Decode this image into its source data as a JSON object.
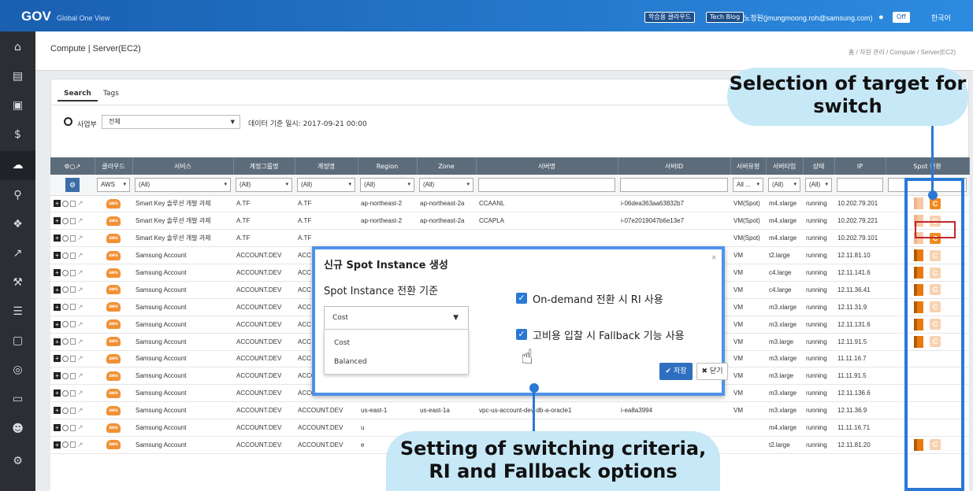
{
  "topbar": {
    "logo": "GOV",
    "logo_sub": "Global One View",
    "btn_learning": "학습용 클라우드",
    "btn_techblog": "Tech Blog",
    "user": "노정원(jmungmoong.roh@samsung.com)",
    "toggle": "Off",
    "lang": "한국어"
  },
  "page": {
    "title": "Compute | Server(EC2)",
    "breadcrumb": "홈 / 자원 관리 / Compute / Server(EC2)"
  },
  "search": {
    "tabs": [
      "Search",
      "Tags"
    ],
    "filter_label": "사업부",
    "filter_value": "전체",
    "data_date": "데이터 기준 일시: 2017-09-21 00:00"
  },
  "grid": {
    "columns": [
      "",
      "클라우드",
      "서비스",
      "계정그룹명",
      "계정명",
      "Region",
      "Zone",
      "서버명",
      "서버ID",
      "서버유형",
      "서버타입",
      "상태",
      "IP",
      "Spot 전환"
    ],
    "filters": [
      "",
      "AWS",
      "(All)",
      "(All)",
      "(All)",
      "(All)",
      "(All)",
      "",
      "",
      "All ...",
      "(All)",
      "(All)",
      "",
      ""
    ],
    "rows": [
      {
        "svc": "Smart Key 솔루션 개발 과제",
        "grp": "A.TF",
        "acct": "A.TF",
        "region": "ap-northeast-2",
        "zone": "ap-northeast-2a",
        "name": "CCAANL",
        "id": "i-06dea363aa63832b7",
        "type": "VM(Spot)",
        "itype": "m4.xlarge",
        "state": "running",
        "ip": "10.202.79.201",
        "spot": "off",
        "c": "on"
      },
      {
        "svc": "Smart Key 솔루션 개발 과제",
        "grp": "A.TF",
        "acct": "A.TF",
        "region": "ap-northeast-2",
        "zone": "ap-northeast-2a",
        "name": "CCAPLA",
        "id": "i-07e2019047b6e13e7",
        "type": "VM(Spot)",
        "itype": "m4.xlarge",
        "state": "running",
        "ip": "10.202.79.221",
        "spot": "off",
        "c": "off"
      },
      {
        "svc": "Smart Key 솔루션 개발 과제",
        "grp": "A.TF",
        "acct": "A.TF",
        "region": "",
        "zone": "",
        "name": "",
        "id": "",
        "type": "VM(Spot)",
        "itype": "m4.xlarge",
        "state": "running",
        "ip": "10.202.79.101",
        "spot": "off",
        "c": "on"
      },
      {
        "svc": "Samsung Account",
        "grp": "ACCOUNT.DEV",
        "acct": "ACC",
        "region": "",
        "zone": "",
        "name": "",
        "id": "",
        "type": "VM",
        "itype": "t2.large",
        "state": "running",
        "ip": "12.11.81.10",
        "spot": "on",
        "c": "off"
      },
      {
        "svc": "Samsung Account",
        "grp": "ACCOUNT.DEV",
        "acct": "ACC",
        "region": "",
        "zone": "",
        "name": "",
        "id": "",
        "type": "VM",
        "itype": "c4.large",
        "state": "running",
        "ip": "12.11.141.6",
        "spot": "on",
        "c": "off"
      },
      {
        "svc": "Samsung Account",
        "grp": "ACCOUNT.DEV",
        "acct": "ACC",
        "region": "",
        "zone": "",
        "name": "",
        "id": "",
        "type": "VM",
        "itype": "c4.large",
        "state": "running",
        "ip": "12.11.36.41",
        "spot": "on",
        "c": "off"
      },
      {
        "svc": "Samsung Account",
        "grp": "ACCOUNT.DEV",
        "acct": "ACC",
        "region": "",
        "zone": "",
        "name": "",
        "id": "",
        "type": "VM",
        "itype": "m3.xlarge",
        "state": "running",
        "ip": "12.11.31.9",
        "spot": "on",
        "c": "off"
      },
      {
        "svc": "Samsung Account",
        "grp": "ACCOUNT.DEV",
        "acct": "ACC",
        "region": "",
        "zone": "",
        "name": "",
        "id": "",
        "type": "VM",
        "itype": "m3.xlarge",
        "state": "running",
        "ip": "12.11.131.6",
        "spot": "on",
        "c": "off"
      },
      {
        "svc": "Samsung Account",
        "grp": "ACCOUNT.DEV",
        "acct": "ACC",
        "region": "",
        "zone": "",
        "name": "",
        "id": "",
        "type": "VM",
        "itype": "m3.large",
        "state": "running",
        "ip": "12.11.91.5",
        "spot": "on",
        "c": "off"
      },
      {
        "svc": "Samsung Account",
        "grp": "ACCOUNT.DEV",
        "acct": "ACC",
        "region": "",
        "zone": "",
        "name": "",
        "id": "",
        "type": "VM",
        "itype": "m3.xlarge",
        "state": "running",
        "ip": "11.11.16.7",
        "spot": "",
        "c": ""
      },
      {
        "svc": "Samsung Account",
        "grp": "ACCOUNT.DEV",
        "acct": "ACCOUNT.DEV",
        "region": "us-east-1",
        "zone": "us-east-1a",
        "name": "vpc-us-account-dev-etc-a-gateway",
        "id": "i-0c6d3167",
        "type": "VM",
        "itype": "m3.large",
        "state": "running",
        "ip": "11.11.91.5",
        "spot": "",
        "c": ""
      },
      {
        "svc": "Samsung Account",
        "grp": "ACCOUNT.DEV",
        "acct": "ACCOUNT.DEV",
        "region": "eu-west-1",
        "zone": "eu-west-1a",
        "name": "vpc-eu-account-dev-db-a-oracle",
        "id": "i-5563bcdf",
        "type": "VM",
        "itype": "m3.xlarge",
        "state": "running",
        "ip": "12.11.136.6",
        "spot": "",
        "c": ""
      },
      {
        "svc": "Samsung Account",
        "grp": "ACCOUNT.DEV",
        "acct": "ACCOUNT.DEV",
        "region": "us-east-1",
        "zone": "us-east-1a",
        "name": "vpc-us-account-dev-db-a-oracle1",
        "id": "i-ea8a3994",
        "type": "VM",
        "itype": "m3.xlarge",
        "state": "running",
        "ip": "12.11.36.9",
        "spot": "",
        "c": ""
      },
      {
        "svc": "Samsung Account",
        "grp": "ACCOUNT.DEV",
        "acct": "ACCOUNT.DEV",
        "region": "u",
        "zone": "",
        "name": "",
        "id": "",
        "type": "",
        "itype": "m4.xlarge",
        "state": "running",
        "ip": "11.11.16.71",
        "spot": "",
        "c": ""
      },
      {
        "svc": "Samsung Account",
        "grp": "ACCOUNT.DEV",
        "acct": "ACCOUNT.DEV",
        "region": "e",
        "zone": "",
        "name": "",
        "id": "",
        "type": "",
        "itype": "t2.large",
        "state": "running",
        "ip": "12.11.81.20",
        "spot": "on",
        "c": "off"
      }
    ]
  },
  "modal": {
    "title": "신규 Spot Instance 생성",
    "criteria_label": "Spot Instance 전환 기준",
    "selected": "Cost",
    "options": [
      "Cost",
      "Balanced"
    ],
    "cb1": "On-demand 전환 시 RI 사용",
    "cb2": "고비용 입찰 시 Fallback 기능 사용",
    "save": "저장",
    "close": "닫기",
    "close_x": "×"
  },
  "callouts": {
    "target": "Selection of target for switch",
    "criteria": "Setting of switching criteria, RI and Fallback options"
  },
  "colors": {
    "accent": "#2a78d4",
    "aws": "#f19135",
    "header": "#5d6c7b"
  }
}
